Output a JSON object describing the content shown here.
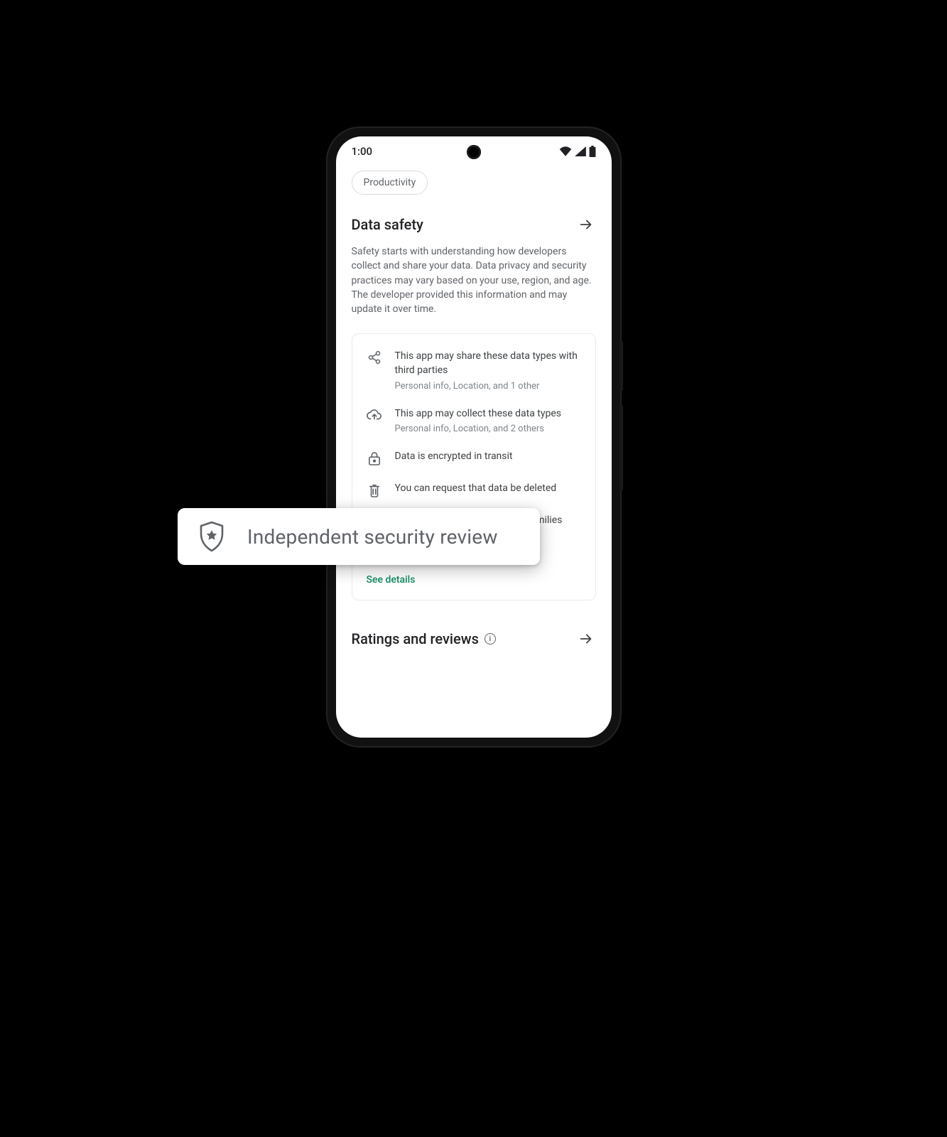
{
  "statusbar": {
    "time": "1:00"
  },
  "chip": {
    "label": "Productivity"
  },
  "data_safety": {
    "heading": "Data safety",
    "body": "Safety starts with understanding how developers collect and share your data. Data privacy and security practices may vary based on your use, region, and age. The developer provided this information and may update it over time.",
    "items": [
      {
        "icon": "share-icon",
        "title": "This app may share these data types with third parties",
        "sub": "Personal info, Location, and 1 other"
      },
      {
        "icon": "cloud-icon",
        "title": "This app may collect these data types",
        "sub": "Personal info, Location, and 2 others"
      },
      {
        "icon": "lock-icon",
        "title": "Data is encrypted in transit",
        "sub": ""
      },
      {
        "icon": "trash-icon",
        "title": "You can request that data be deleted",
        "sub": ""
      },
      {
        "icon": "face-icon",
        "title": "Committed to follow the Play Families Policy",
        "sub": ""
      }
    ],
    "see_details": "See details"
  },
  "ratings": {
    "heading": "Ratings and reviews"
  },
  "callout": {
    "label": "Independent security review"
  }
}
